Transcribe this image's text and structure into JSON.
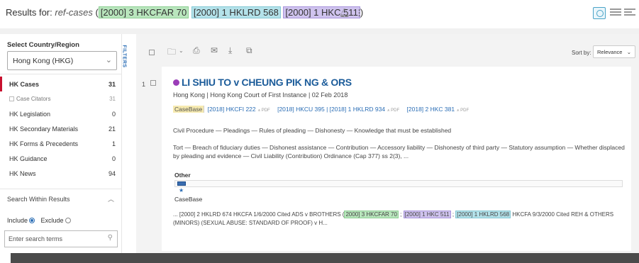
{
  "header": {
    "results_prefix": "Results for:",
    "query": "ref-cases",
    "open_paren": " (",
    "close_paren": ")",
    "chips": [
      {
        "text": "[2000] 3 HKCFAR 70",
        "color": "green"
      },
      {
        "text": "[2000] 1 HKLRD 568",
        "color": "blue"
      },
      {
        "text": "[2000] 1 HKC 511",
        "color": "purple"
      }
    ],
    "icons": [
      "bell-icon",
      "more-icon"
    ]
  },
  "sidebar": {
    "country_label": "Select Country/Region",
    "country_value": "Hong Kong (HKG)",
    "categories": [
      {
        "label": "HK Cases",
        "count": "31"
      },
      {
        "label": "Case Citators",
        "count": "31"
      },
      {
        "label": "HK Legislation",
        "count": "0"
      },
      {
        "label": "HK Secondary Materials",
        "count": "21"
      },
      {
        "label": "HK Forms & Precedents",
        "count": "1"
      },
      {
        "label": "HK Guidance",
        "count": "0"
      },
      {
        "label": "HK News",
        "count": "94"
      }
    ],
    "search_within_title": "Search Within Results",
    "include_label": "Include",
    "exclude_label": "Exclude",
    "search_placeholder": "Enter search terms",
    "filters_label": "FILTERS"
  },
  "toolbar": {
    "sort_label": "Sort by:",
    "sort_value": "Relevance"
  },
  "result": {
    "number": "1",
    "title": "LI SHIU TO v CHEUNG PIK NG & ORS",
    "court_info": "Hong Kong | Hong Kong Court of First Instance | 02 Feb 2018",
    "casebase_tag": "CaseBase",
    "citations": [
      "[2018] HKCFI 222",
      "[2018] HKCU 395",
      "[2018] 1 HKLRD 934",
      "[2018] 2 HKC 381"
    ],
    "pdf_label": "PDF",
    "catchwords_1": "Civil Procedure — Pleadings — Rules of pleading — Dishonesty — Knowledge that must be established",
    "catchwords_2": "Tort — Breach of fiduciary duties — Dishonest assistance — Contribution — Accessory liability — Dishonesty of third party — Statutory assumption — Whether displaced by pleading and evidence — Civil Liability (Contribution) Ordinance (Cap 377) ss 2(3), ...",
    "other_label": "Other",
    "casebase_label": "CaseBase",
    "snippet_a": "... [2000] 2 HKLRD 674 HKCFA 1/6/2000 Cited ADS v BROTHERS (",
    "snippet_hl_1": "2000] 3 HKCFAR 70",
    "snippet_sep_1": " ; ",
    "snippet_hl_2": "[2000] 1 HKC 511",
    "snippet_sep_2": " ; ",
    "snippet_hl_3": "[2000] 1 HKLRD 568",
    "snippet_b": " HKCFA 9/3/2000 Cited REH & OTHERS (MINORS) (SEXUAL ABUSE: STANDARD OF PROOF) v H..."
  },
  "colors": {
    "accent": "#c8102e",
    "link": "#1c5c9a",
    "hl_green": "#b9e6bd",
    "hl_blue": "#b4e2ea",
    "hl_purple": "#cfc3ee"
  }
}
